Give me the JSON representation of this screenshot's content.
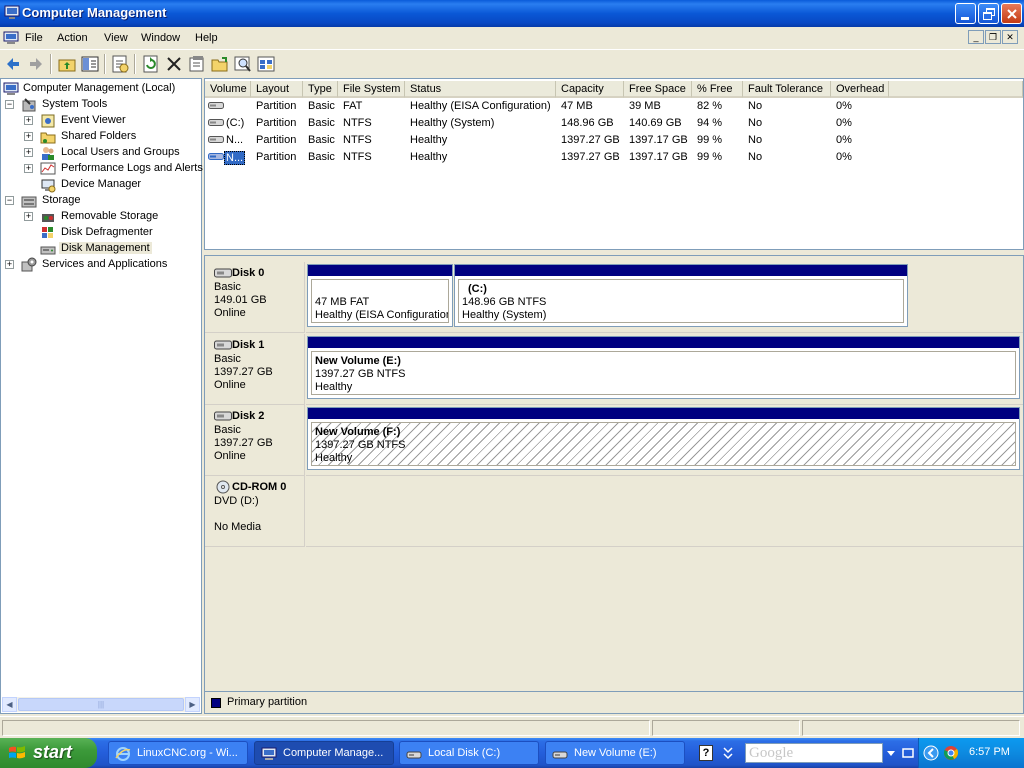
{
  "window": {
    "title": "Computer Management",
    "controls": {
      "minimize": "_",
      "maximize": "❐",
      "close": "✕"
    }
  },
  "menubar": {
    "items": [
      "File",
      "Action",
      "View",
      "Window",
      "Help"
    ],
    "mdi": {
      "minimize": "_",
      "restore": "❐",
      "close": "✕"
    }
  },
  "toolbar": {
    "buttons": [
      "back-arrow",
      "forward-arrow",
      "up-folder",
      "show-hide-console-tree",
      "properties",
      "refresh",
      "delete",
      "properties-sheet",
      "open-folder",
      "search",
      "settings"
    ]
  },
  "tree": {
    "root": "Computer Management (Local)",
    "system_tools": "System Tools",
    "event_viewer": "Event Viewer",
    "shared_folders": "Shared Folders",
    "local_users": "Local Users and Groups",
    "perf_logs": "Performance Logs and Alerts",
    "device_manager": "Device Manager",
    "storage": "Storage",
    "removable_storage": "Removable Storage",
    "disk_defrag": "Disk Defragmenter",
    "disk_management": "Disk Management",
    "services_apps": "Services and Applications",
    "expand_symbol": "+",
    "collapse_symbol": "−",
    "scroll_left": "◀",
    "scroll_right": "▶",
    "scroll_grip": "|||"
  },
  "volume_list": {
    "columns": [
      "Volume",
      "Layout",
      "Type",
      "File System",
      "Status",
      "Capacity",
      "Free Space",
      "% Free",
      "Fault Tolerance",
      "Overhead"
    ],
    "rows": [
      {
        "volume": "",
        "layout": "Partition",
        "type": "Basic",
        "fs": "FAT",
        "status": "Healthy (EISA Configuration)",
        "capacity": "47 MB",
        "free": "39 MB",
        "pct_free": "82 %",
        "fault": "No",
        "overhead": "0%"
      },
      {
        "volume": "(C:)",
        "layout": "Partition",
        "type": "Basic",
        "fs": "NTFS",
        "status": "Healthy (System)",
        "capacity": "148.96 GB",
        "free": "140.69 GB",
        "pct_free": "94 %",
        "fault": "No",
        "overhead": "0%"
      },
      {
        "volume": "N...",
        "layout": "Partition",
        "type": "Basic",
        "fs": "NTFS",
        "status": "Healthy",
        "capacity": "1397.27 GB",
        "free": "1397.17 GB",
        "pct_free": "99 %",
        "fault": "No",
        "overhead": "0%"
      },
      {
        "volume": "N...",
        "layout": "Partition",
        "type": "Basic",
        "fs": "NTFS",
        "status": "Healthy",
        "capacity": "1397.27 GB",
        "free": "1397.17 GB",
        "pct_free": "99 %",
        "fault": "No",
        "overhead": "0%"
      }
    ]
  },
  "disks": {
    "disk0": {
      "name": "Disk 0",
      "type": "Basic",
      "size": "149.01 GB",
      "state": "Online",
      "p1": {
        "line1": "47 MB FAT",
        "line2": "Healthy (EISA Configuration)"
      },
      "p2": {
        "label": "(C:)",
        "line1": "148.96 GB NTFS",
        "line2": "Healthy (System)"
      }
    },
    "disk1": {
      "name": "Disk 1",
      "type": "Basic",
      "size": "1397.27 GB",
      "state": "Online",
      "p1": {
        "label": "New Volume  (E:)",
        "line1": "1397.27 GB NTFS",
        "line2": "Healthy"
      }
    },
    "disk2": {
      "name": "Disk 2",
      "type": "Basic",
      "size": "1397.27 GB",
      "state": "Online",
      "p1": {
        "label": "New Volume  (F:)",
        "line1": "1397.27 GB NTFS",
        "line2": "Healthy"
      }
    },
    "cdrom0": {
      "name": "CD-ROM 0",
      "line1": "DVD (D:)",
      "line2": "No Media"
    }
  },
  "legend": {
    "primary": "Primary partition",
    "primary_color": "#000080"
  },
  "taskbar": {
    "start": "start",
    "tasks": [
      {
        "label": "LinuxCNC.org - Wi...",
        "icon": "ie-icon"
      },
      {
        "label": "Computer Manage...",
        "icon": "computer-management-icon"
      },
      {
        "label": "Local Disk (C:)",
        "icon": "drive-icon"
      },
      {
        "label": "New Volume (E:)",
        "icon": "drive-icon"
      }
    ],
    "help": "?",
    "search_placeholder": "Google",
    "clock": "6:57 PM"
  },
  "colors": {
    "titlebar": "#0a58d6",
    "selection": "#316ac5",
    "partition_bar": "#000080",
    "taskbar": "#245edb",
    "start_green": "#3c9a3a"
  }
}
